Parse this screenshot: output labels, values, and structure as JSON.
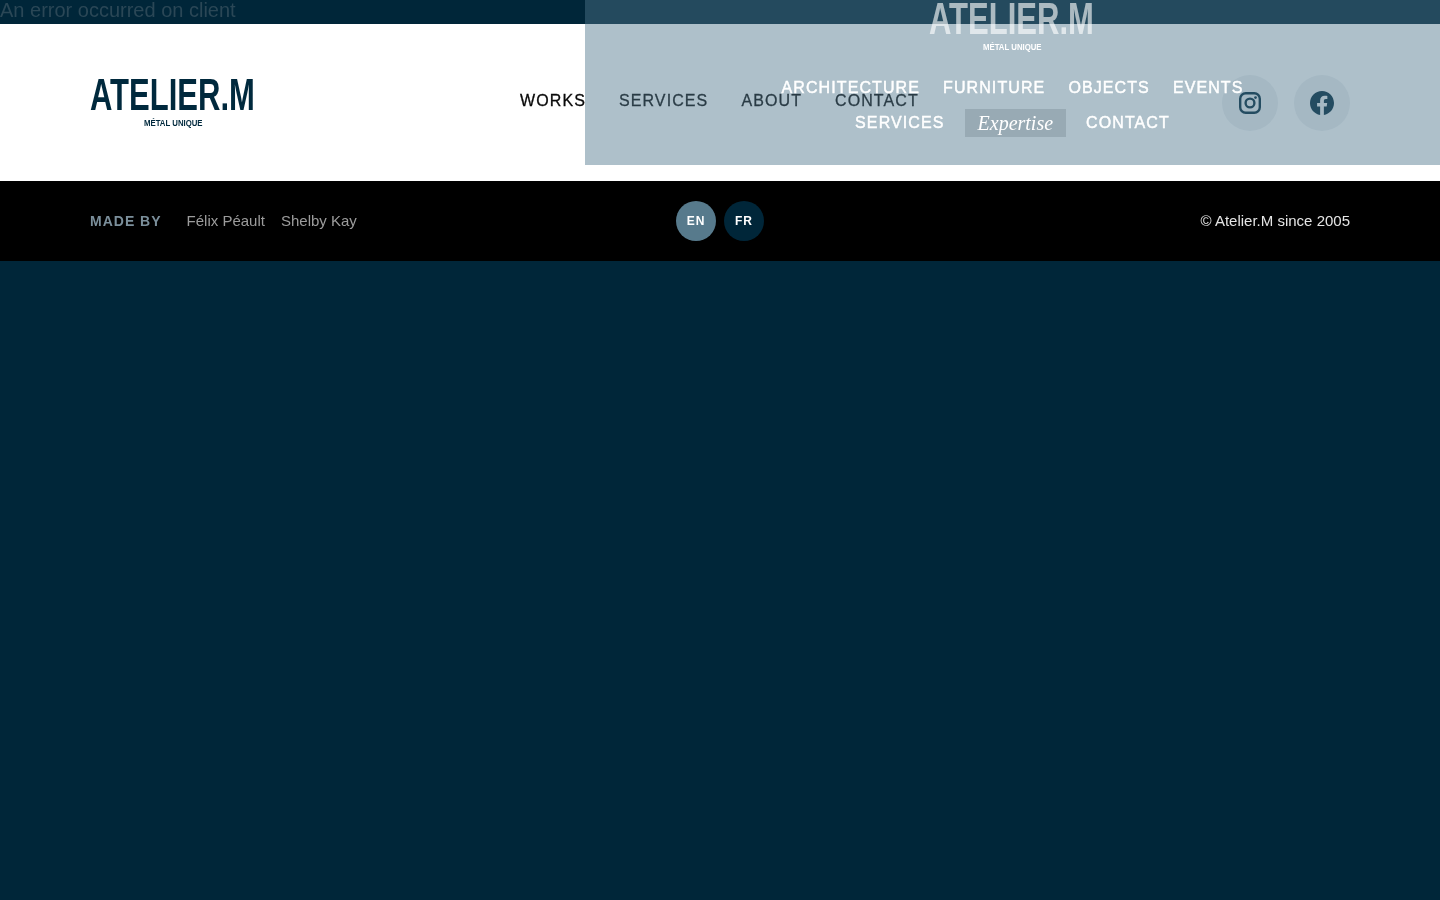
{
  "error_message": "An error occurred on client",
  "header": {
    "logo": {
      "wordmark": "ATELIER.M",
      "tagline": "MÉTAL UNIQUE"
    },
    "nav": [
      {
        "label": "WORKS"
      },
      {
        "label": "SERVICES"
      },
      {
        "label": "ABOUT"
      },
      {
        "label": "CONTACT"
      }
    ],
    "social_links": [
      {
        "kind": "instagram"
      },
      {
        "kind": "facebook"
      }
    ]
  },
  "menu_overlay": {
    "logo": {
      "wordmark": "ATELIER.M",
      "tagline": "MÉTAL UNIQUE"
    },
    "rows": [
      {
        "items": [
          {
            "label": "ARCHITECTURE",
            "selected": false
          },
          {
            "label": "FURNITURE",
            "selected": false
          },
          {
            "label": "OBJECTS",
            "selected": false
          },
          {
            "label": "EVENTS",
            "selected": false
          }
        ]
      },
      {
        "items": [
          {
            "label": "SERVICES",
            "selected": false
          },
          {
            "label": "Expertise",
            "selected": true
          },
          {
            "label": "CONTACT",
            "selected": false
          }
        ]
      }
    ]
  },
  "footer": {
    "made_by_label": "MADE BY",
    "credits": [
      "Félix Péault",
      "Shelby Kay"
    ],
    "languages": [
      {
        "label": "EN",
        "selected": true
      },
      {
        "label": "FR",
        "selected": false
      }
    ],
    "copyright": "© Atelier.M since 2005"
  }
}
